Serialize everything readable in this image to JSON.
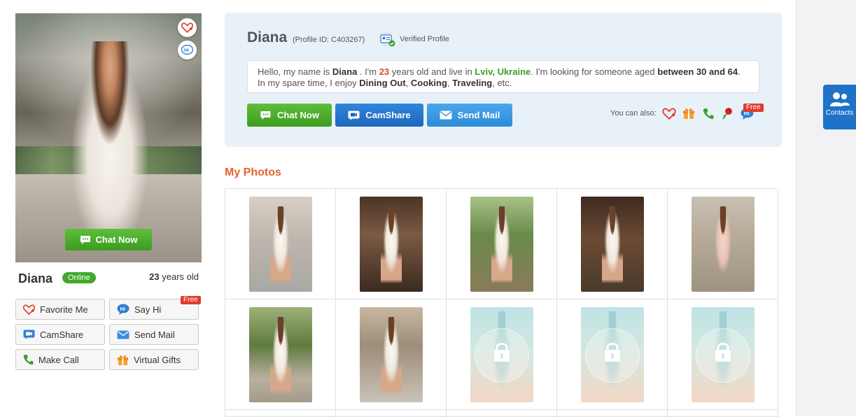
{
  "profile": {
    "name": "Diana",
    "online_label": "Online",
    "age_number": "23",
    "age_suffix": " years old",
    "profile_id": "(Profile ID: C403267)",
    "verified_label": "Verified Profile"
  },
  "bio": {
    "p1": "Hello, my name is ",
    "name": "Diana",
    "p2": " . I'm ",
    "age": "23",
    "p3": " years old and live in ",
    "location": "Lviv, Ukraine",
    "p4": ". I'm looking for someone aged ",
    "range": "between 30 and 64",
    "p5": ". In my spare time, I enjoy ",
    "h1": "Dining Out",
    "p6": ", ",
    "h2": "Cooking",
    "p7": ", ",
    "h3": "Traveling",
    "p8": ", etc."
  },
  "main_photo": {
    "chat_label": "Chat Now",
    "favorite_icon": "heart-plus-icon",
    "hi_icon": "hi-bubble-icon"
  },
  "actions": {
    "favorite": "Favorite Me",
    "say_hi": "Say Hi",
    "free": "Free",
    "camshare": "CamShare",
    "send_mail": "Send Mail",
    "make_call": "Make Call",
    "virtual_gifts": "Virtual Gifts"
  },
  "cta": {
    "chat": "Chat Now",
    "camshare": "CamShare",
    "mail": "Send Mail",
    "can_also": "You can also:",
    "free": "Free",
    "icons": [
      "heart-plus-icon",
      "gift-icon",
      "phone-icon",
      "rose-icon",
      "hi-bubble-icon"
    ]
  },
  "photos": {
    "title": "My Photos",
    "items": [
      {
        "locked": false
      },
      {
        "locked": false
      },
      {
        "locked": false
      },
      {
        "locked": false
      },
      {
        "locked": false
      },
      {
        "locked": false
      },
      {
        "locked": false
      },
      {
        "locked": true
      },
      {
        "locked": true
      },
      {
        "locked": true
      }
    ]
  },
  "sidebar": {
    "contacts_label": "Contacts"
  },
  "colors": {
    "green": "#41a92b",
    "blue": "#1e72c8",
    "accent_orange": "#e8632a",
    "red": "#e03a2f"
  }
}
